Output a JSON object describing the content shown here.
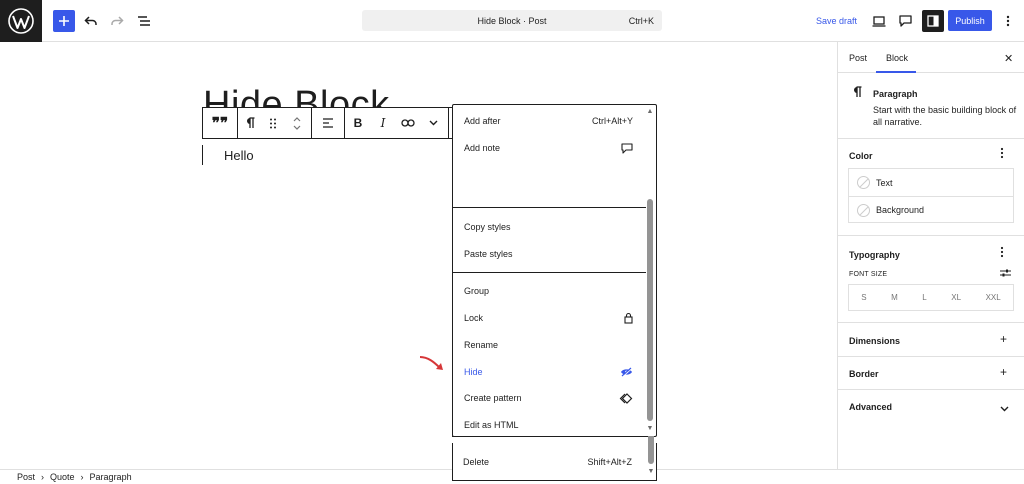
{
  "header": {
    "command_title": "Hide Block · Post",
    "command_shortcut": "Ctrl+K",
    "save_draft": "Save draft",
    "publish": "Publish"
  },
  "canvas": {
    "post_title": "Hide Block",
    "paragraph": "Hello"
  },
  "menu": {
    "items": [
      {
        "label": "Add after",
        "right": "Ctrl+Alt+Y"
      },
      {
        "label": "Add note",
        "right": ""
      },
      {
        "label": "Copy styles",
        "right": ""
      },
      {
        "label": "Paste styles",
        "right": ""
      },
      {
        "label": "Group",
        "right": ""
      },
      {
        "label": "Lock",
        "right": ""
      },
      {
        "label": "Rename",
        "right": ""
      },
      {
        "label": "Hide",
        "right": ""
      },
      {
        "label": "Create pattern",
        "right": ""
      },
      {
        "label": "Edit as HTML",
        "right": ""
      },
      {
        "label": "Delete",
        "right": "Shift+Alt+Z"
      }
    ],
    "highlight_color": "#3858e9"
  },
  "breadcrumb": [
    "Post",
    "Quote",
    "Paragraph"
  ],
  "sidebar": {
    "tabs": [
      "Post",
      "Block"
    ],
    "block": {
      "title": "Paragraph",
      "description": "Start with the basic building block of all narrative."
    },
    "color": {
      "title": "Color",
      "options": [
        "Text",
        "Background"
      ]
    },
    "typography": {
      "title": "Typography",
      "font_size_label": "FONT SIZE",
      "sizes": [
        "S",
        "M",
        "L",
        "XL",
        "XXL"
      ]
    },
    "dimensions": "Dimensions",
    "border": "Border",
    "advanced": "Advanced"
  },
  "colors": {
    "accent": "#3858e9",
    "dark": "#1e1e1e",
    "arrow": "#d63638"
  }
}
